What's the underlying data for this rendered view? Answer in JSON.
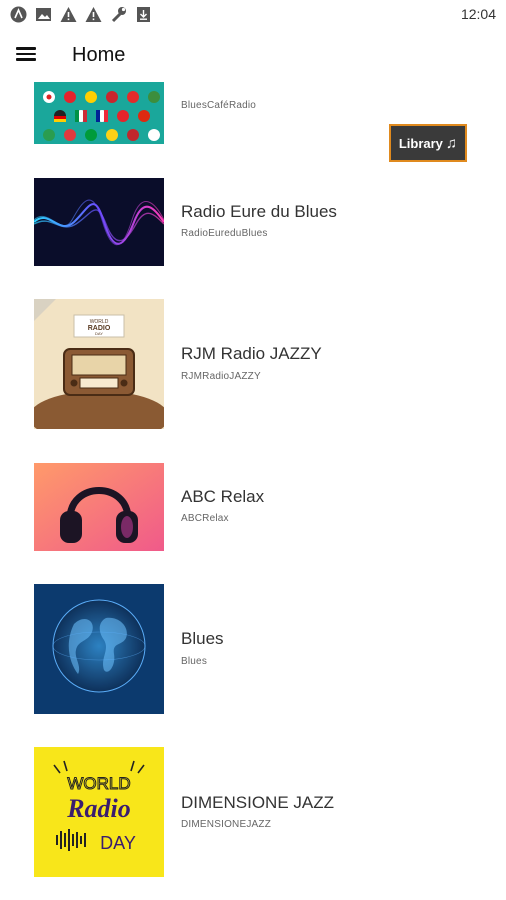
{
  "status_bar": {
    "time": "12:04",
    "icons": [
      "android-icon",
      "image-icon",
      "warning-icon",
      "warning-icon",
      "wrench-icon",
      "download-icon"
    ]
  },
  "app_bar": {
    "menu_icon": "menu-icon",
    "title": "Home"
  },
  "library_button": {
    "label": "Library",
    "icon": "music-note-icon",
    "note_glyph": "♫"
  },
  "stations": [
    {
      "title": "",
      "subtitle": "BluesCaféRadio",
      "art": "flags"
    },
    {
      "title": "Radio Eure du Blues",
      "subtitle": "RadioEureduBlues",
      "art": "wave"
    },
    {
      "title": "RJM Radio JAZZY",
      "subtitle": "RJMRadioJAZZY",
      "art": "vintage-radio"
    },
    {
      "title": "ABC Relax",
      "subtitle": "ABCRelax",
      "art": "headphones"
    },
    {
      "title": "Blues",
      "subtitle": "Blues",
      "art": "globe"
    },
    {
      "title": "DIMENSIONE JAZZ",
      "subtitle": "DIMENSIONEJAZZ",
      "art": "world-radio-day"
    }
  ],
  "artwork_text": {
    "vintage_radio_banner": [
      "WORLD",
      "RADIO",
      "DAY"
    ],
    "world_radio_day": [
      "WORLD",
      "Radio",
      "DAY"
    ]
  },
  "colors": {
    "accent_border": "#e08a1e",
    "library_bg": "#3a3a3a",
    "flags_bg": "#1aa79b",
    "wave_bg": "#0a0d2a",
    "radio_bg": "#f2e3c4",
    "headphones_bg": "#f7708a",
    "globe_bg": "#0c3a6e",
    "wrd_bg": "#f8e61a"
  }
}
